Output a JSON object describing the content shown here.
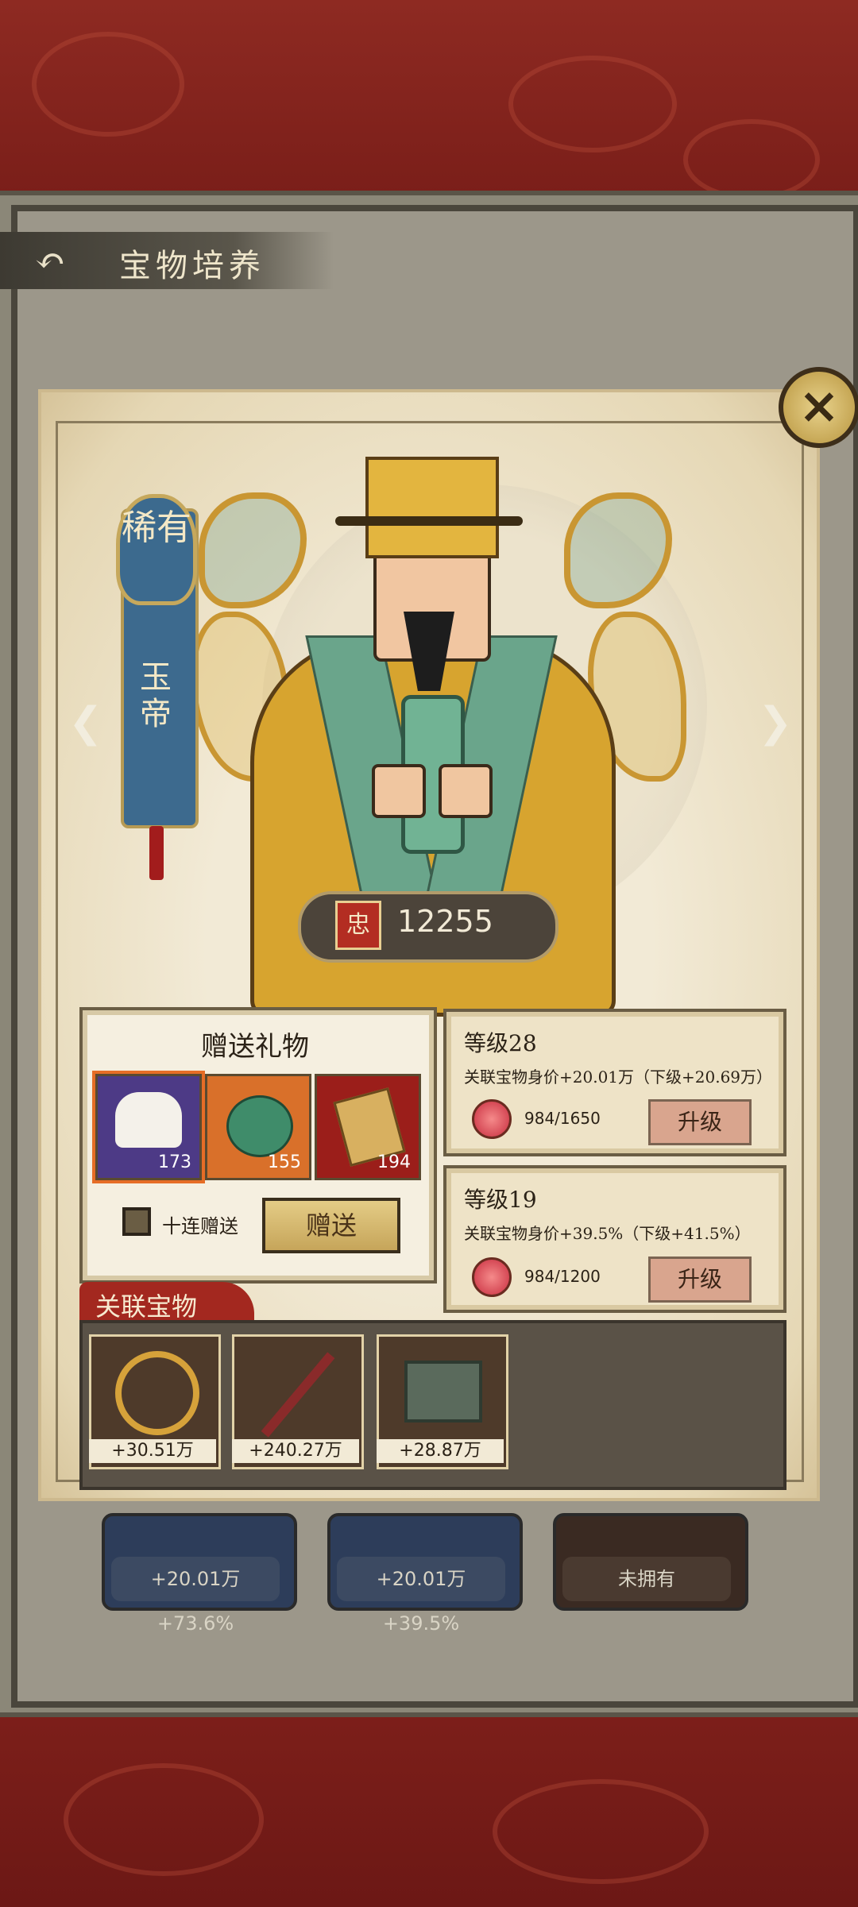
{
  "header": {
    "title": "宝物培养",
    "back_icon": "back-arrow-icon"
  },
  "hero": {
    "rarity": "稀有",
    "name": "玉帝",
    "loyalty_icon_label": "忠",
    "loyalty_value": "12255"
  },
  "gift": {
    "title": "赠送礼物",
    "items": [
      {
        "name": "white-cloth",
        "count": "173",
        "selected": true
      },
      {
        "name": "jade-pendant",
        "count": "155",
        "selected": false
      },
      {
        "name": "gold-tablet",
        "count": "194",
        "selected": false
      }
    ],
    "ten_label": "十连赠送",
    "send_label": "赠送"
  },
  "levels": [
    {
      "title": "等级28",
      "desc": "关联宝物身价+20.01万（下级+20.69万）",
      "progress": "984/1650",
      "button": "升级"
    },
    {
      "title": "等级19",
      "desc": "关联宝物身价+39.5%（下级+41.5%）",
      "progress": "984/1200",
      "button": "升级"
    }
  ],
  "related": {
    "title": "关联宝物",
    "items": [
      {
        "name": "golden-bow",
        "value": "+30.51万"
      },
      {
        "name": "red-sword",
        "value": "+240.27万"
      },
      {
        "name": "bronze-cauldron",
        "value": "+28.87万"
      }
    ]
  },
  "background_cards": [
    {
      "label": "+20.01万 +73.6%"
    },
    {
      "label": "+20.01万 +39.5%"
    },
    {
      "label": "未拥有"
    }
  ]
}
